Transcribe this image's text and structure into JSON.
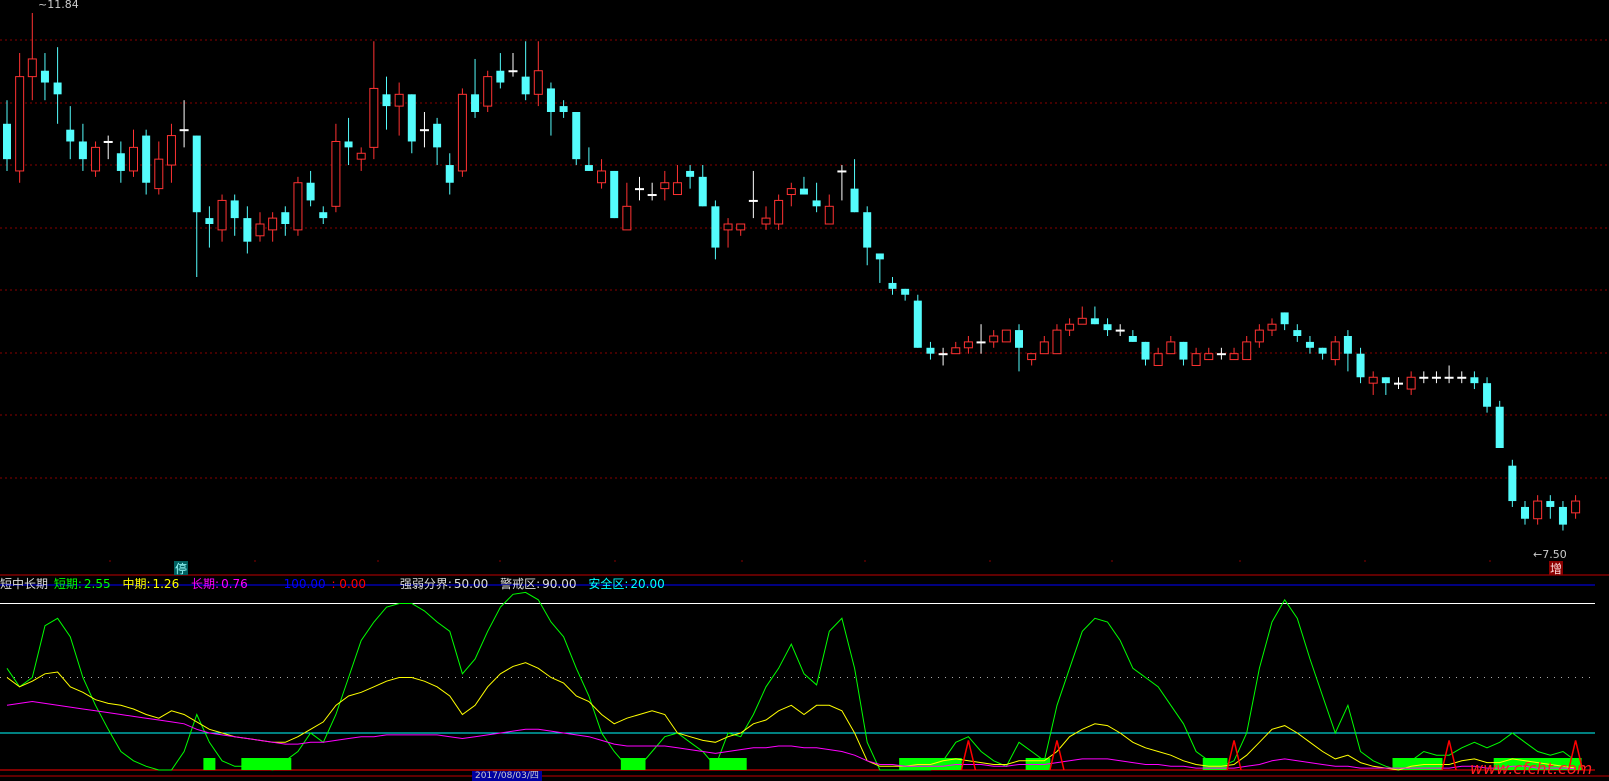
{
  "chart_data": [
    {
      "type": "candlestick",
      "title": "",
      "ylim": [
        7.2,
        11.95
      ],
      "price_labels": {
        "high": "11.84",
        "low": "7.50"
      },
      "markers": {
        "stop": "停",
        "increase": "增"
      },
      "candles": [
        [
          10.9,
          10.6,
          11.1,
          10.5
        ],
        [
          10.5,
          11.3,
          11.5,
          10.4
        ],
        [
          11.3,
          11.45,
          11.84,
          11.1
        ],
        [
          11.35,
          11.25,
          11.5,
          11.1
        ],
        [
          11.25,
          11.15,
          11.55,
          10.9
        ],
        [
          10.85,
          10.75,
          11.05,
          10.6
        ],
        [
          10.75,
          10.6,
          10.9,
          10.5
        ],
        [
          10.5,
          10.7,
          10.75,
          10.45
        ],
        [
          10.75,
          10.75,
          10.8,
          10.6
        ],
        [
          10.65,
          10.5,
          10.75,
          10.4
        ],
        [
          10.5,
          10.7,
          10.85,
          10.45
        ],
        [
          10.8,
          10.4,
          10.85,
          10.3
        ],
        [
          10.35,
          10.6,
          10.75,
          10.3
        ],
        [
          10.55,
          10.8,
          10.9,
          10.4
        ],
        [
          10.85,
          10.85,
          11.1,
          10.7
        ],
        [
          10.8,
          10.15,
          10.8,
          9.6
        ],
        [
          10.1,
          10.05,
          10.2,
          9.85
        ],
        [
          10.0,
          10.25,
          10.3,
          9.9
        ],
        [
          10.25,
          10.1,
          10.3,
          9.95
        ],
        [
          10.1,
          9.9,
          10.2,
          9.8
        ],
        [
          9.95,
          10.05,
          10.15,
          9.9
        ],
        [
          10.0,
          10.1,
          10.15,
          9.9
        ],
        [
          10.15,
          10.05,
          10.2,
          9.95
        ],
        [
          10.0,
          10.4,
          10.45,
          9.95
        ],
        [
          10.4,
          10.25,
          10.5,
          10.2
        ],
        [
          10.15,
          10.1,
          10.2,
          10.05
        ],
        [
          10.2,
          10.75,
          10.9,
          10.15
        ],
        [
          10.75,
          10.7,
          10.95,
          10.55
        ],
        [
          10.6,
          10.65,
          10.7,
          10.5
        ],
        [
          10.7,
          11.2,
          11.6,
          10.6
        ],
        [
          11.15,
          11.05,
          11.3,
          10.85
        ],
        [
          11.05,
          11.15,
          11.25,
          10.8
        ],
        [
          11.15,
          10.75,
          11.15,
          10.65
        ],
        [
          10.85,
          10.85,
          11.0,
          10.7
        ],
        [
          10.9,
          10.7,
          10.95,
          10.55
        ],
        [
          10.55,
          10.4,
          10.65,
          10.3
        ],
        [
          10.5,
          11.15,
          11.2,
          10.45
        ],
        [
          11.15,
          11.0,
          11.45,
          10.95
        ],
        [
          11.05,
          11.3,
          11.35,
          11.0
        ],
        [
          11.35,
          11.25,
          11.5,
          11.2
        ],
        [
          11.35,
          11.35,
          11.5,
          11.3
        ],
        [
          11.3,
          11.15,
          11.6,
          11.1
        ],
        [
          11.15,
          11.35,
          11.6,
          11.05
        ],
        [
          11.2,
          11.0,
          11.25,
          10.8
        ],
        [
          11.05,
          11.0,
          11.1,
          10.95
        ],
        [
          11.0,
          10.6,
          11.0,
          10.55
        ],
        [
          10.55,
          10.5,
          10.7,
          10.5
        ],
        [
          10.4,
          10.5,
          10.6,
          10.35
        ],
        [
          10.5,
          10.1,
          10.5,
          10.1
        ],
        [
          10.0,
          10.2,
          10.4,
          10.0
        ],
        [
          10.35,
          10.35,
          10.45,
          10.25
        ],
        [
          10.3,
          10.3,
          10.4,
          10.25
        ],
        [
          10.35,
          10.4,
          10.5,
          10.25
        ],
        [
          10.3,
          10.4,
          10.55,
          10.3
        ],
        [
          10.5,
          10.45,
          10.55,
          10.35
        ],
        [
          10.45,
          10.2,
          10.55,
          10.2
        ],
        [
          10.2,
          9.85,
          10.25,
          9.75
        ],
        [
          10.0,
          10.05,
          10.1,
          9.85
        ],
        [
          10.0,
          10.05,
          10.05,
          9.95
        ],
        [
          10.25,
          10.25,
          10.5,
          10.1
        ],
        [
          10.05,
          10.1,
          10.2,
          10.0
        ],
        [
          10.05,
          10.25,
          10.3,
          10.0
        ],
        [
          10.3,
          10.35,
          10.4,
          10.2
        ],
        [
          10.35,
          10.3,
          10.45,
          10.3
        ],
        [
          10.25,
          10.2,
          10.4,
          10.15
        ],
        [
          10.05,
          10.2,
          10.3,
          10.05
        ],
        [
          10.5,
          10.5,
          10.55,
          10.25
        ],
        [
          10.35,
          10.15,
          10.6,
          10.15
        ],
        [
          10.15,
          9.85,
          10.2,
          9.7
        ],
        [
          9.8,
          9.75,
          9.8,
          9.55
        ],
        [
          9.55,
          9.5,
          9.6,
          9.45
        ],
        [
          9.5,
          9.45,
          9.5,
          9.4
        ],
        [
          9.4,
          9.0,
          9.45,
          9.0
        ],
        [
          9.0,
          8.95,
          9.05,
          8.9
        ],
        [
          8.95,
          8.95,
          9.0,
          8.85
        ],
        [
          8.95,
          9.0,
          9.05,
          8.95
        ],
        [
          9.0,
          9.05,
          9.1,
          8.95
        ],
        [
          9.05,
          9.05,
          9.2,
          8.95
        ],
        [
          9.05,
          9.1,
          9.15,
          9.0
        ],
        [
          9.05,
          9.15,
          9.15,
          9.05
        ],
        [
          9.15,
          9.0,
          9.2,
          8.8
        ],
        [
          8.9,
          8.95,
          8.95,
          8.85
        ],
        [
          8.95,
          9.05,
          9.1,
          8.95
        ],
        [
          8.95,
          9.15,
          9.2,
          8.95
        ],
        [
          9.15,
          9.2,
          9.25,
          9.1
        ],
        [
          9.2,
          9.25,
          9.35,
          9.2
        ],
        [
          9.25,
          9.2,
          9.35,
          9.2
        ],
        [
          9.2,
          9.15,
          9.25,
          9.1
        ],
        [
          9.15,
          9.15,
          9.2,
          9.1
        ],
        [
          9.1,
          9.05,
          9.15,
          9.05
        ],
        [
          9.05,
          8.9,
          9.05,
          8.85
        ],
        [
          8.85,
          8.95,
          9.0,
          8.85
        ],
        [
          8.95,
          9.05,
          9.1,
          8.95
        ],
        [
          9.05,
          8.9,
          9.05,
          8.85
        ],
        [
          8.85,
          8.95,
          9.0,
          8.85
        ],
        [
          8.9,
          8.95,
          9.0,
          8.9
        ],
        [
          8.95,
          8.95,
          9.0,
          8.9
        ],
        [
          8.9,
          8.95,
          9.0,
          8.9
        ],
        [
          8.9,
          9.05,
          9.1,
          8.9
        ],
        [
          9.05,
          9.15,
          9.2,
          9.0
        ],
        [
          9.15,
          9.2,
          9.25,
          9.1
        ],
        [
          9.3,
          9.2,
          9.3,
          9.15
        ],
        [
          9.15,
          9.1,
          9.2,
          9.05
        ],
        [
          9.05,
          9.0,
          9.1,
          8.95
        ],
        [
          9.0,
          8.95,
          9.0,
          8.9
        ],
        [
          8.9,
          9.05,
          9.1,
          8.85
        ],
        [
          9.1,
          8.95,
          9.15,
          8.8
        ],
        [
          8.95,
          8.75,
          9.0,
          8.7
        ],
        [
          8.7,
          8.75,
          8.8,
          8.6
        ],
        [
          8.75,
          8.7,
          8.75,
          8.6
        ],
        [
          8.7,
          8.7,
          8.75,
          8.65
        ],
        [
          8.65,
          8.75,
          8.8,
          8.6
        ],
        [
          8.75,
          8.75,
          8.8,
          8.7
        ],
        [
          8.75,
          8.75,
          8.8,
          8.7
        ],
        [
          8.75,
          8.75,
          8.85,
          8.7
        ],
        [
          8.75,
          8.75,
          8.8,
          8.7
        ],
        [
          8.75,
          8.7,
          8.8,
          8.65
        ],
        [
          8.7,
          8.5,
          8.75,
          8.45
        ],
        [
          8.5,
          8.15,
          8.55,
          8.15
        ],
        [
          8.0,
          7.7,
          8.05,
          7.65
        ],
        [
          7.65,
          7.55,
          7.7,
          7.5
        ],
        [
          7.55,
          7.7,
          7.75,
          7.5
        ],
        [
          7.7,
          7.65,
          7.75,
          7.55
        ],
        [
          7.65,
          7.5,
          7.7,
          7.45
        ],
        [
          7.6,
          7.7,
          7.75,
          7.55
        ]
      ],
      "candle_fields": [
        "open",
        "close",
        "high",
        "low"
      ]
    },
    {
      "type": "line",
      "title": "",
      "ylim": [
        0,
        100
      ],
      "reference_lines": [
        {
          "value": 100,
          "color": "#0000ff"
        },
        {
          "value": 90,
          "color": "#ffffff"
        },
        {
          "value": 50,
          "color": "#aaaaaa",
          "style": "dotted"
        },
        {
          "value": 20,
          "color": "#00ffff"
        },
        {
          "value": 0,
          "color": "#ff0000"
        }
      ],
      "series": [
        {
          "name": "短期",
          "color": "#00ff00",
          "values": [
            55,
            45,
            50,
            78,
            82,
            72,
            50,
            35,
            22,
            10,
            5,
            2,
            0,
            0,
            10,
            30,
            15,
            5,
            2,
            2,
            2,
            0,
            5,
            10,
            20,
            15,
            30,
            50,
            70,
            80,
            88,
            90,
            90,
            86,
            80,
            75,
            52,
            60,
            75,
            88,
            95,
            96,
            92,
            80,
            72,
            55,
            40,
            20,
            10,
            2,
            2,
            10,
            18,
            20,
            15,
            10,
            2,
            20,
            18,
            30,
            45,
            55,
            68,
            52,
            46,
            75,
            82,
            55,
            15,
            0,
            0,
            0,
            0,
            0,
            5,
            15,
            18,
            10,
            5,
            2,
            15,
            10,
            5,
            35,
            55,
            75,
            82,
            80,
            70,
            55,
            50,
            45,
            35,
            25,
            10,
            5,
            2,
            5,
            20,
            55,
            80,
            92,
            82,
            60,
            40,
            20,
            35,
            10,
            5,
            2,
            0,
            5,
            10,
            8,
            8,
            12,
            15,
            12,
            15,
            20,
            15,
            10,
            8,
            10,
            5
          ],
          "latest": "2.55"
        },
        {
          "name": "中期",
          "color": "#ffff00",
          "values": [
            50,
            45,
            48,
            52,
            53,
            45,
            42,
            38,
            36,
            35,
            33,
            30,
            28,
            32,
            30,
            26,
            22,
            20,
            18,
            17,
            16,
            15,
            15,
            18,
            22,
            26,
            35,
            40,
            42,
            45,
            48,
            50,
            50,
            48,
            45,
            40,
            30,
            35,
            45,
            52,
            56,
            58,
            55,
            50,
            47,
            40,
            37,
            30,
            25,
            28,
            30,
            32,
            30,
            20,
            18,
            16,
            15,
            18,
            20,
            25,
            27,
            32,
            35,
            30,
            35,
            35,
            32,
            20,
            5,
            2,
            2,
            2,
            3,
            3,
            5,
            6,
            5,
            4,
            3,
            3,
            5,
            5,
            5,
            10,
            18,
            22,
            25,
            24,
            20,
            15,
            12,
            10,
            8,
            5,
            3,
            2,
            2,
            3,
            8,
            15,
            22,
            24,
            20,
            15,
            10,
            6,
            8,
            4,
            2,
            1,
            0,
            2,
            3,
            3,
            3,
            5,
            6,
            4,
            4,
            6,
            5,
            4,
            3,
            2,
            1
          ],
          "latest": "1.26"
        },
        {
          "name": "长期",
          "color": "#ff00ff",
          "values": [
            35,
            36,
            37,
            36,
            35,
            34,
            33,
            32,
            31,
            30,
            29,
            28,
            27,
            26,
            25,
            22,
            20,
            19,
            18,
            17,
            16,
            15,
            14,
            14,
            15,
            15,
            16,
            17,
            18,
            18,
            19,
            19,
            19,
            19,
            19,
            18,
            17,
            18,
            19,
            20,
            21,
            22,
            22,
            21,
            20,
            19,
            18,
            16,
            14,
            13,
            13,
            13,
            13,
            12,
            11,
            10,
            9,
            10,
            11,
            12,
            12,
            13,
            13,
            12,
            12,
            11,
            10,
            8,
            5,
            3,
            3,
            2,
            2,
            2,
            2,
            3,
            3,
            3,
            2,
            2,
            3,
            3,
            3,
            4,
            5,
            6,
            6,
            6,
            5,
            4,
            3,
            3,
            2,
            2,
            1,
            1,
            1,
            1,
            2,
            3,
            5,
            6,
            5,
            4,
            3,
            2,
            2,
            1,
            1,
            1,
            1,
            1,
            1,
            1,
            1,
            2,
            2,
            1,
            1,
            2,
            2,
            1,
            1,
            1,
            0.76
          ],
          "latest": "0.76"
        }
      ],
      "signal_zones": [
        [
          16,
          16
        ],
        [
          19,
          22
        ],
        [
          49,
          50
        ],
        [
          56,
          58
        ],
        [
          71,
          75
        ],
        [
          81,
          82
        ],
        [
          95,
          96
        ],
        [
          110,
          113
        ],
        [
          118,
          124
        ]
      ],
      "signal_peaks": [
        76,
        83,
        97,
        114,
        124
      ]
    }
  ],
  "indicator_header": {
    "name": "短中长期",
    "short_label": "短期:",
    "short_value": "2.55",
    "mid_label": "中期:",
    "mid_value": "1.26",
    "long_label": "长期:",
    "long_value": "0.76",
    "upper_value": "100.00",
    "lower_value": ": 0.00",
    "divide_label": "强弱分界:",
    "divide_value": "50.00",
    "warn_label": "警戒区:",
    "warn_value": "90.00",
    "safe_label": "安全区:",
    "safe_value": "20.00"
  },
  "bottom_axis": {
    "highlighted_date": "2017/08/03/四"
  },
  "watermark": "www.cfcht.com",
  "colors": {
    "grid": "#880000",
    "rise": "#ff3232",
    "fall": "#54fcfc",
    "panel_border": "#c00000"
  }
}
